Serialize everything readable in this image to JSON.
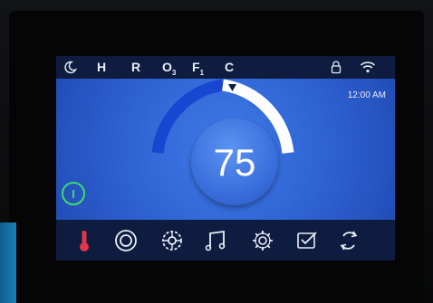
{
  "status_bar": {
    "items": [
      {
        "label": "H"
      },
      {
        "label": "R"
      },
      {
        "label": "O",
        "sub": "3"
      },
      {
        "label": "F",
        "sub": "1"
      },
      {
        "label": "C"
      }
    ],
    "icons": [
      "moon-icon",
      "lock-icon",
      "wifi-icon"
    ]
  },
  "clock": {
    "time": "12:00 AM"
  },
  "thermostat": {
    "temperature": "75",
    "setpoint_level_percent": 60
  },
  "power": {
    "icon": "power-icon"
  },
  "bottom_bar": {
    "icons": [
      "thermometer-icon",
      "jets-icon",
      "pump-icon",
      "music-icon",
      "settings-icon",
      "checklist-icon",
      "refresh-icon"
    ]
  },
  "colors": {
    "screen": "#2d5fcf",
    "bar": "#0e1c3f",
    "dial_blue": "#1746d0",
    "dial_white": "#ffffff",
    "power_green": "#3ddc6a",
    "thermometer_red": "#e0354a"
  }
}
